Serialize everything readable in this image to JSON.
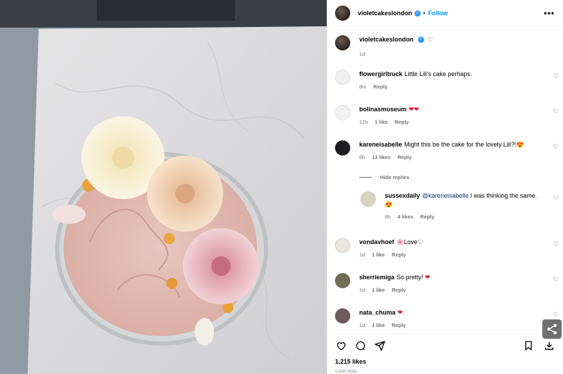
{
  "post": {
    "author": "violetcakeslondon",
    "follow_label": "Follow",
    "dot": "•",
    "more": "•••"
  },
  "caption": {
    "username": "violetcakeslondon",
    "time": "1d"
  },
  "comments": [
    {
      "username": "flowergirltruck",
      "text": "Little Lili's cake perhaps.",
      "time": "8m",
      "likes": "",
      "reply": "Reply"
    },
    {
      "username": "bolinasmuseum",
      "text": "",
      "emoji": "❤❤",
      "time": "12h",
      "likes": "1 like",
      "reply": "Reply"
    },
    {
      "username": "kareneisabelle",
      "text": "Might this be the cake for the lovely Lili?!",
      "emoji": "😍",
      "time": "6h",
      "likes": "13 likes",
      "reply": "Reply"
    },
    {
      "username": "vondavhoef",
      "text": "Love",
      "emoji_pre": "🌸",
      "emoji_post": "♡",
      "time": "1d",
      "likes": "1 like",
      "reply": "Reply"
    },
    {
      "username": "sherriemiga",
      "text": "So pretty!",
      "emoji": "❤",
      "time": "1d",
      "likes": "1 like",
      "reply": "Reply"
    },
    {
      "username": "nata_chuma",
      "text": "",
      "emoji": "❤",
      "time": "1d",
      "likes": "1 like",
      "reply": "Reply"
    }
  ],
  "hide_replies": "Hide replies",
  "reply": {
    "username": "sussexdaily",
    "mention": "@kareneisabelle",
    "text": "I was thinking the same.",
    "emoji": "😍",
    "time": "6h",
    "likes": "4 likes",
    "reply": "Reply"
  },
  "likes_count": "1,215 likes",
  "timestamp": "1 DAY AGO",
  "icons": [
    "heart-icon",
    "comment-icon",
    "share-icon",
    "bookmark-icon",
    "download-icon",
    "more-icon",
    "verified-icon"
  ],
  "colors": {
    "accent": "#0095f6",
    "red_heart": "#e0192e",
    "muted": "#737373"
  }
}
